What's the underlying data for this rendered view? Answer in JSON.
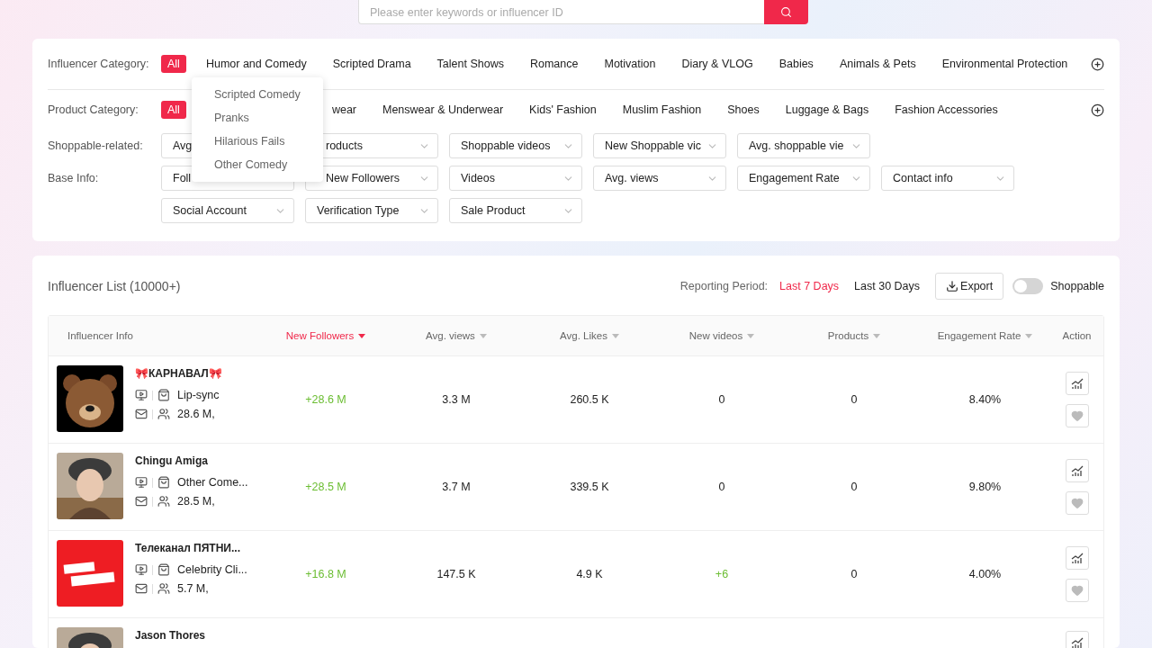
{
  "search": {
    "placeholder": "Please enter keywords or influencer ID"
  },
  "filters": {
    "influencer_category": {
      "label": "Influencer Category:",
      "items": [
        {
          "label": "All",
          "selected": true
        },
        {
          "label": "Humor and Comedy",
          "selected": false,
          "menu": [
            "Scripted Comedy",
            "Pranks",
            "Hilarious Fails",
            "Other Comedy"
          ]
        },
        {
          "label": "Scripted Drama",
          "selected": false
        },
        {
          "label": "Talent Shows",
          "selected": false
        },
        {
          "label": "Romance",
          "selected": false
        },
        {
          "label": "Motivation",
          "selected": false
        },
        {
          "label": "Diary & VLOG",
          "selected": false
        },
        {
          "label": "Babies",
          "selected": false
        },
        {
          "label": "Animals & Pets",
          "selected": false
        },
        {
          "label": "Environmental Protection",
          "selected": false
        }
      ]
    },
    "product_category": {
      "label": "Product Category:",
      "items": [
        {
          "label": "All",
          "selected": true
        },
        {
          "label": "wear",
          "selected": false,
          "covered": true
        },
        {
          "label": "Menswear & Underwear",
          "selected": false
        },
        {
          "label": "Kids' Fashion",
          "selected": false
        },
        {
          "label": "Muslim Fashion",
          "selected": false
        },
        {
          "label": "Shoes",
          "selected": false
        },
        {
          "label": "Luggage & Bags",
          "selected": false
        },
        {
          "label": "Fashion Accessories",
          "selected": false
        }
      ]
    },
    "select_rows": [
      {
        "label": "Shoppable-related:",
        "selects": [
          {
            "value": "Avg"
          },
          {
            "value": "roducts",
            "covered": true
          },
          {
            "value": "Shoppable videos"
          },
          {
            "value": "New Shoppable vic"
          },
          {
            "value": "Avg. shoppable vie"
          }
        ]
      },
      {
        "label": "Base Info:",
        "selects": [
          {
            "value": "Foll"
          },
          {
            "value": "New Followers",
            "covered": true
          },
          {
            "value": "Videos"
          },
          {
            "value": "Avg. views"
          },
          {
            "value": "Engagement Rate"
          },
          {
            "value": "Contact info"
          }
        ]
      },
      {
        "label": "",
        "selects": [
          {
            "value": "Social Account"
          },
          {
            "value": "Verification Type"
          },
          {
            "value": "Sale Product"
          }
        ]
      }
    ]
  },
  "list": {
    "title": "Influencer List",
    "count": "(10000+)",
    "period_label": "Reporting Period:",
    "periods": [
      {
        "label": "Last 7 Days",
        "selected": true
      },
      {
        "label": "Last 30 Days",
        "selected": false
      }
    ],
    "export": "Export",
    "shoppable": {
      "label": "Shoppable",
      "on": false
    }
  },
  "table": {
    "columns": [
      {
        "label": "Influencer Info",
        "sortable": false,
        "selected": false
      },
      {
        "label": "New Followers",
        "sortable": true,
        "selected": true
      },
      {
        "label": "Avg. views",
        "sortable": true,
        "selected": false
      },
      {
        "label": "Avg. Likes",
        "sortable": true,
        "selected": false
      },
      {
        "label": "New videos",
        "sortable": true,
        "selected": false
      },
      {
        "label": "Products",
        "sortable": true,
        "selected": false
      },
      {
        "label": "Engagement Rate",
        "sortable": true,
        "selected": false
      },
      {
        "label": "Action",
        "sortable": false,
        "selected": false
      }
    ],
    "rows": [
      {
        "name": "🎀КАРНАВАЛ🎀",
        "category": "Lip-sync",
        "followers": "28.6 M,",
        "new_followers": "+28.6 M",
        "avg_views": "3.3 M",
        "avg_likes": "260.5 K",
        "new_videos": "0",
        "new_videos_up": false,
        "products": "0",
        "engagement": "8.40%"
      },
      {
        "name": "Chingu Amiga",
        "category": "Other Come...",
        "followers": "28.5 M,",
        "new_followers": "+28.5 M",
        "avg_views": "3.7 M",
        "avg_likes": "339.5 K",
        "new_videos": "0",
        "new_videos_up": false,
        "products": "0",
        "engagement": "9.80%"
      },
      {
        "name": "Телеканал ПЯТНИ...",
        "category": "Celebrity Cli...",
        "followers": "5.7 M,",
        "new_followers": "+16.8 M",
        "avg_views": "147.5 K",
        "avg_likes": "4.9 K",
        "new_videos": "+6",
        "new_videos_up": true,
        "products": "0",
        "engagement": "4.00%"
      },
      {
        "name": "Jason Thores"
      }
    ]
  }
}
